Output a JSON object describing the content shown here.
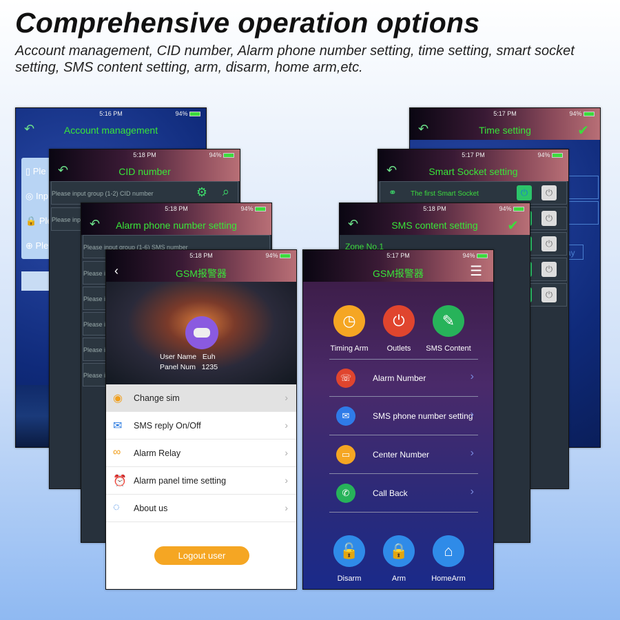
{
  "heading": "Comprehensive operation options",
  "subheading": "Account management, CID number, Alarm phone number setting, time setting, smart socket setting, SMS content setting, arm, disarm, home arm,etc.",
  "status": {
    "time_a": "5:16 PM",
    "time_b": "5:18 PM",
    "time_c": "5:17 PM",
    "battery": "94%"
  },
  "account": {
    "title": "Account management",
    "fields": [
      "Ple",
      "Inp",
      "Ple",
      "Ple"
    ]
  },
  "cid": {
    "title": "CID number",
    "rows": [
      "Please input group (1-2) CID number",
      "Please inpu"
    ]
  },
  "alarm_phone": {
    "title": "Alarm phone number setting",
    "rows": [
      "Please input group (1-6) SMS number",
      "Please i",
      "Please i",
      "Please i",
      "Please i",
      "Please i"
    ]
  },
  "gsm_left": {
    "title": "GSM报警器",
    "user_name_label": "User Name",
    "user_name": "Euh",
    "panel_num_label": "Panel Num",
    "panel_num": "1235",
    "menu": [
      {
        "label": "Change sim",
        "icon": "user-circle-icon"
      },
      {
        "label": "SMS reply On/Off",
        "icon": "message-icon"
      },
      {
        "label": "Alarm Relay",
        "icon": "infinity-icon"
      },
      {
        "label": "Alarm panel time setting",
        "icon": "alarm-clock-icon"
      },
      {
        "label": "About us",
        "icon": "chat-icon"
      }
    ],
    "logout": "Logout user"
  },
  "time_setting": {
    "title": "Time setting",
    "day_label": "ay"
  },
  "smart_socket": {
    "title": "Smart Socket setting",
    "first": "The first Smart Socket"
  },
  "sms_content": {
    "title": "SMS content setting",
    "zone": "Zone No.1"
  },
  "gsm_right": {
    "title": "GSM报警器",
    "top": [
      {
        "label": "Timing Arm",
        "color": "#f5a623"
      },
      {
        "label": "Outlets",
        "color": "#e0452e"
      },
      {
        "label": "SMS Content",
        "color": "#27b35a"
      }
    ],
    "rows": [
      {
        "label": "Alarm Number",
        "color": "#e0452e"
      },
      {
        "label": "SMS phone number setting",
        "color": "#2f7be8"
      },
      {
        "label": "Center Number",
        "color": "#f5a623"
      },
      {
        "label": "Call Back",
        "color": "#27b35a"
      }
    ],
    "bottom": [
      {
        "label": "Disarm"
      },
      {
        "label": "Arm"
      },
      {
        "label": "HomeArm"
      }
    ]
  },
  "colors": {
    "accent_green": "#39e639",
    "logout": "#f5a623",
    "arm_blue": "#2f8be8"
  }
}
